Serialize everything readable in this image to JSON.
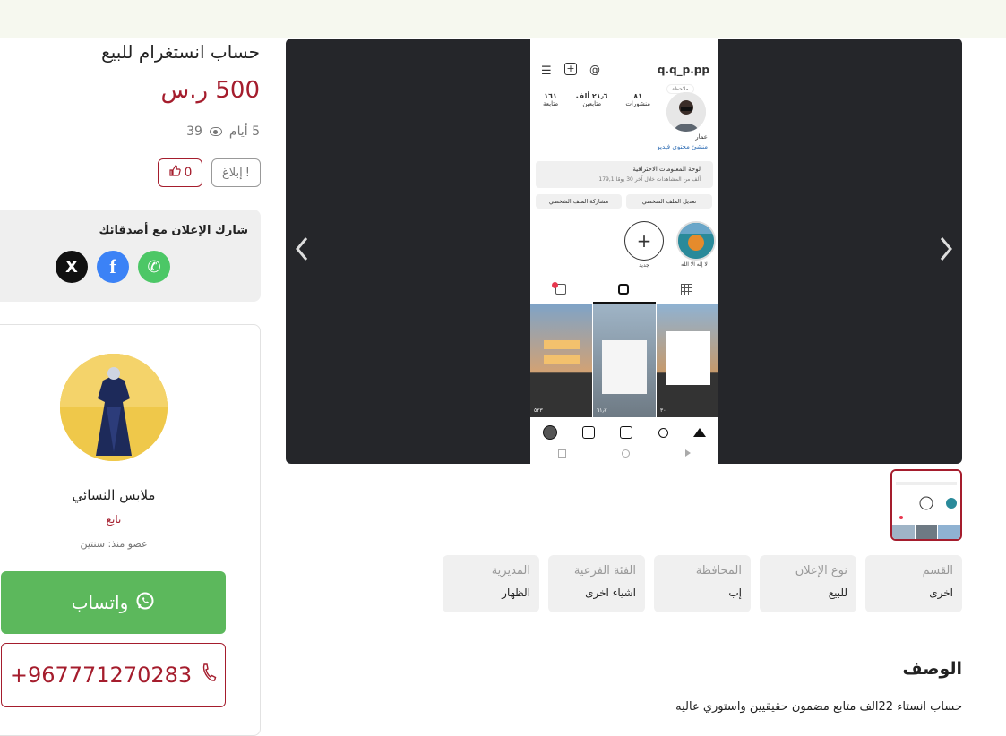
{
  "listing": {
    "title": "حساب انستغرام للبيع",
    "price": "500 ر.س",
    "age": "5 أيام",
    "views": "39",
    "report_label": "إبلاغ",
    "likes": "0"
  },
  "share": {
    "title": "شارك الإعلان مع أصدقائك",
    "x_glyph": "X",
    "facebook_glyph": "f",
    "whatsapp_glyph": "✆"
  },
  "seller": {
    "name": "ملابس النسائي",
    "follow_label": "تابع",
    "member_since": "عضو منذ: سنتين",
    "whatsapp_label": "واتساب",
    "phone": "+967771270283"
  },
  "gallery": {
    "phone_screenshot": {
      "username": "q.q_p.pp",
      "posts_count": "٨١",
      "posts_label": "منشورات",
      "followers_count": "٢١٫٦ ألف",
      "followers_label": "متابعين",
      "following_count": "١٦١",
      "following_label": "متابعة",
      "note_label": "ملاحظة",
      "display_name": "عمار",
      "bio_link": "منشئ محتوى فيديو",
      "dashboard_title": "لوحة المعلومات الاحترافية",
      "dashboard_sub": "179,1 ألف من المشاهدات خلال آخر 30 يومًا",
      "edit_profile": "تعديل الملف الشخصي",
      "share_profile": "مشاركة الملف الشخصي",
      "highlight_name": "لا إله الا الله",
      "new_label": "جديد",
      "reel_1_views": "٥٢٣",
      "reel_2_views": "٦١٫٧",
      "reel_3_views": "٣٠"
    }
  },
  "details": [
    {
      "label": "القسم",
      "value": "اخرى"
    },
    {
      "label": "نوع الإعلان",
      "value": "للبيع"
    },
    {
      "label": "المحافظة",
      "value": "إب"
    },
    {
      "label": "الفئة الفرعية",
      "value": "اشياء اخرى"
    },
    {
      "label": "المديرية",
      "value": "الظهار"
    }
  ],
  "description": {
    "title": "الوصف",
    "text": "حساب انستاء 22الف متابع مضمون حقيقيين واستوري عاليه"
  },
  "colors": {
    "accent": "#a51d2d",
    "whatsapp": "#5cb85c",
    "topbar": "#f6f8ef"
  }
}
